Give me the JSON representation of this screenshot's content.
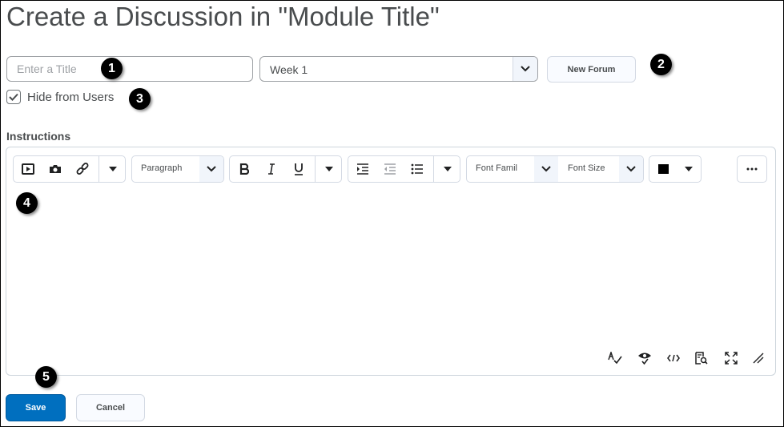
{
  "page": {
    "title": "Create a Discussion in \"Module Title\""
  },
  "form": {
    "title_placeholder": "Enter a Title",
    "forum_selected": "Week 1",
    "new_forum_label": "New Forum",
    "hide_from_users_label": "Hide from Users",
    "hide_from_users_checked": true,
    "instructions_label": "Instructions"
  },
  "toolbar": {
    "paragraph_label": "Paragraph",
    "font_family_label": "Font Famil",
    "font_size_label": "Font Size",
    "text_color": "#000000"
  },
  "actions": {
    "save_label": "Save",
    "cancel_label": "Cancel"
  },
  "callouts": [
    "1",
    "2",
    "3",
    "4",
    "5"
  ],
  "colors": {
    "primary": "#006fbf",
    "border": "#9ea1a5",
    "text": "#494c4e"
  }
}
